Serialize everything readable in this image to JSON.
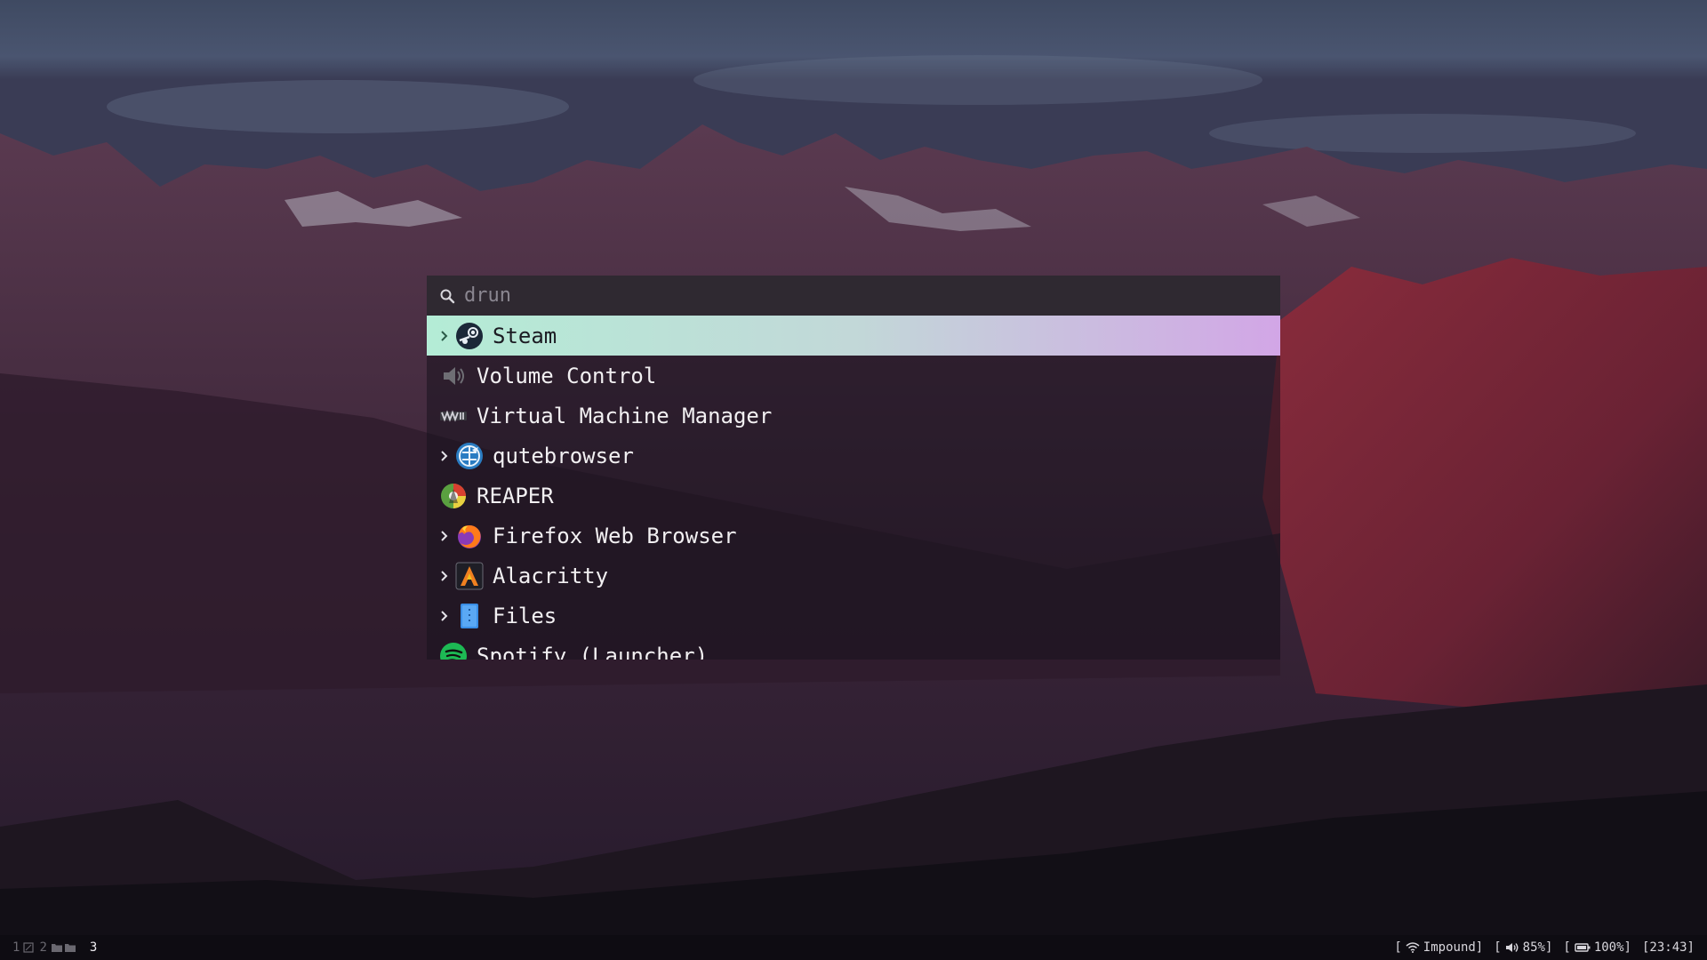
{
  "launcher": {
    "search_placeholder": "drun",
    "entries": [
      {
        "label": "Steam",
        "icon": "steam-icon",
        "expandable": true,
        "selected": true
      },
      {
        "label": "Volume Control",
        "icon": "volume-control-icon",
        "expandable": false
      },
      {
        "label": "Virtual Machine Manager",
        "icon": "virt-manager-icon",
        "expandable": false
      },
      {
        "label": "qutebrowser",
        "icon": "qutebrowser-icon",
        "expandable": true
      },
      {
        "label": "REAPER",
        "icon": "reaper-icon",
        "expandable": false
      },
      {
        "label": "Firefox Web Browser",
        "icon": "firefox-icon",
        "expandable": true
      },
      {
        "label": "Alacritty",
        "icon": "alacritty-icon",
        "expandable": true
      },
      {
        "label": "Files",
        "icon": "files-icon",
        "expandable": true
      },
      {
        "label": "Spotify (Launcher)",
        "icon": "spotify-icon",
        "expandable": false
      }
    ],
    "colors": {
      "selected_start": "#b4ecd6",
      "selected_end": "#d2a6e6"
    }
  },
  "status_bar": {
    "workspaces": [
      {
        "number": "1",
        "icon": "window-icon"
      },
      {
        "number": "2",
        "icon": "folder-icon"
      },
      {
        "number": "3",
        "active": true
      }
    ],
    "network": {
      "prefix": "[",
      "value": "Impound]",
      "icon": "wifi-icon"
    },
    "volume": {
      "prefix": "[",
      "value": "85%]",
      "icon": "speaker-icon"
    },
    "battery": {
      "prefix": "[",
      "value": "100%]",
      "icon": "battery-icon"
    },
    "clock": "[23:43]"
  }
}
